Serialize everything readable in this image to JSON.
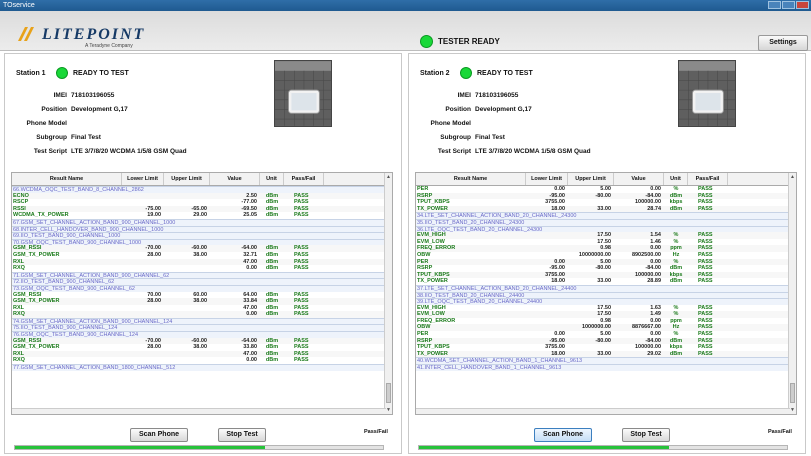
{
  "window": {
    "title": "TOservice"
  },
  "header": {
    "logo_text": "LITEPOINT",
    "logo_sub": "A Teradyne Company",
    "tester_status": "TESTER READY",
    "settings_label": "Settings"
  },
  "stations": [
    {
      "title": "Station 1",
      "status": "READY TO TEST",
      "info": {
        "imei_label": "IMEI",
        "imei": "718103196055",
        "position_label": "Position",
        "position": "Development G,17",
        "phone_model_label": "Phone Model",
        "phone_model": "",
        "subgroup_label": "Subgroup",
        "subgroup": "Final Test",
        "script_label": "Test Script",
        "script": "LTE 3/7/8/20 WCDMA 1/5/8 GSM Quad"
      },
      "buttons": {
        "scan": "Scan Phone",
        "stop": "Stop Test"
      },
      "pass_fail": "Pass/Fail",
      "progress": 0.68,
      "columns": [
        "Result Name",
        "Lower Limit",
        "Upper Limit",
        "Value",
        "Unit",
        "Pass/Fail"
      ],
      "rows": [
        {
          "s": 1,
          "name": "66.WCDMA_OQC_TEST_BAND_8_CHANNEL_2862"
        },
        {
          "name": "ECNO",
          "lo": "",
          "hi": "",
          "val": "2.50",
          "unit": "dBm",
          "pf": "PASS"
        },
        {
          "name": "RSCP",
          "lo": "",
          "hi": "",
          "val": "-77.00",
          "unit": "dBm",
          "pf": "PASS"
        },
        {
          "name": "RSSI",
          "lo": "-75.00",
          "hi": "-65.00",
          "val": "-69.50",
          "unit": "dBm",
          "pf": "PASS"
        },
        {
          "name": "WCDMA_TX_POWER",
          "lo": "19.00",
          "hi": "29.00",
          "val": "25.05",
          "unit": "dBm",
          "pf": "PASS"
        },
        {
          "s": 1,
          "name": "67.GSM_SET_CHANNEL_ACTION_BAND_900_CHANNEL_1000"
        },
        {
          "s": 1,
          "name": "68.INTER_CELL_HANDOVER_BAND_900_CHANNEL_1000"
        },
        {
          "s": 1,
          "name": "69.IIO_TEST_BAND_900_CHANNEL_1000"
        },
        {
          "s": 1,
          "name": "70.GSM_OQC_TEST_BAND_900_CHANNEL_1000"
        },
        {
          "name": "GSM_RSSI",
          "lo": "-70.00",
          "hi": "-60.00",
          "val": "-64.00",
          "unit": "dBm",
          "pf": "PASS"
        },
        {
          "name": "GSM_TX_POWER",
          "lo": "28.00",
          "hi": "38.00",
          "val": "32.71",
          "unit": "dBm",
          "pf": "PASS"
        },
        {
          "name": "RXL",
          "lo": "",
          "hi": "",
          "val": "47.00",
          "unit": "dBm",
          "pf": "PASS"
        },
        {
          "name": "RXQ",
          "lo": "",
          "hi": "",
          "val": "0.00",
          "unit": "dBm",
          "pf": "PASS"
        },
        {
          "s": 1,
          "name": "71.GSM_SET_CHANNEL_ACTION_BAND_900_CHANNEL_62"
        },
        {
          "s": 1,
          "name": "72.IIO_TEST_BAND_900_CHANNEL_62"
        },
        {
          "s": 1,
          "name": "73.GSM_OQC_TEST_BAND_900_CHANNEL_62"
        },
        {
          "name": "GSM_RSSI",
          "lo": "70.00",
          "hi": "60.00",
          "val": "64.00",
          "unit": "dBm",
          "pf": "PASS"
        },
        {
          "name": "GSM_TX_POWER",
          "lo": "28.00",
          "hi": "38.00",
          "val": "33.84",
          "unit": "dBm",
          "pf": "PASS"
        },
        {
          "name": "RXL",
          "lo": "",
          "hi": "",
          "val": "47.00",
          "unit": "dBm",
          "pf": "PASS"
        },
        {
          "name": "RXQ",
          "lo": "",
          "hi": "",
          "val": "0.00",
          "unit": "dBm",
          "pf": "PASS"
        },
        {
          "s": 1,
          "name": "74.GSM_SET_CHANNEL_ACTION_BAND_900_CHANNEL_124"
        },
        {
          "s": 1,
          "name": "75.IIO_TEST_BAND_900_CHANNEL_124"
        },
        {
          "s": 1,
          "name": "76.GSM_OQC_TEST_BAND_900_CHANNEL_124"
        },
        {
          "name": "GSM_RSSI",
          "lo": "-70.00",
          "hi": "-60.00",
          "val": "-64.00",
          "unit": "dBm",
          "pf": "PASS"
        },
        {
          "name": "GSM_TX_POWER",
          "lo": "28.00",
          "hi": "38.00",
          "val": "33.80",
          "unit": "dBm",
          "pf": "PASS"
        },
        {
          "name": "RXL",
          "lo": "",
          "hi": "",
          "val": "47.00",
          "unit": "dBm",
          "pf": "PASS"
        },
        {
          "name": "RXQ",
          "lo": "",
          "hi": "",
          "val": "0.00",
          "unit": "dBm",
          "pf": "PASS"
        },
        {
          "s": 1,
          "name": "77.GSM_SET_CHANNEL_ACTION_BAND_1800_CHANNEL_512"
        }
      ]
    },
    {
      "title": "Station 2",
      "status": "READY TO TEST",
      "info": {
        "imei_label": "IMEI",
        "imei": "718103196055",
        "position_label": "Position",
        "position": "Development G,17",
        "phone_model_label": "Phone Model",
        "phone_model": "",
        "subgroup_label": "Subgroup",
        "subgroup": "Final Test",
        "script_label": "Test Script",
        "script": "LTE 3/7/8/20 WCDMA 1/5/8 GSM Quad"
      },
      "buttons": {
        "scan": "Scan Phone",
        "stop": "Stop Test"
      },
      "pass_fail": "Pass/Fail",
      "progress": 0.68,
      "columns": [
        "Result Name",
        "Lower Limit",
        "Upper Limit",
        "Value",
        "Unit",
        "Pass/Fail"
      ],
      "rows": [
        {
          "name": "PER",
          "lo": "0.00",
          "hi": "5.00",
          "val": "0.00",
          "unit": "%",
          "pf": "PASS"
        },
        {
          "name": "RSRP",
          "lo": "-95.00",
          "hi": "-80.00",
          "val": "-84.00",
          "unit": "dBm",
          "pf": "PASS"
        },
        {
          "name": "TPUT_KBPS",
          "lo": "3755.00",
          "hi": "",
          "val": "100000.00",
          "unit": "kbps",
          "pf": "PASS"
        },
        {
          "name": "TX_POWER",
          "lo": "18.00",
          "hi": "33.00",
          "val": "28.74",
          "unit": "dBm",
          "pf": "PASS"
        },
        {
          "s": 1,
          "name": "34.LTE_SET_CHANNEL_ACTION_BAND_20_CHANNEL_24300"
        },
        {
          "s": 1,
          "name": "35.IIO_TEST_BAND_20_CHANNEL_24300"
        },
        {
          "s": 1,
          "name": "36.LTE_OQC_TEST_BAND_20_CHANNEL_24300"
        },
        {
          "name": "EVM_HIGH",
          "lo": "",
          "hi": "17.50",
          "val": "1.54",
          "unit": "%",
          "pf": "PASS"
        },
        {
          "name": "EVM_LOW",
          "lo": "",
          "hi": "17.50",
          "val": "1.46",
          "unit": "%",
          "pf": "PASS"
        },
        {
          "name": "FREQ_ERROR",
          "lo": "",
          "hi": "0.98",
          "val": "0.00",
          "unit": "ppm",
          "pf": "PASS"
        },
        {
          "name": "OBW",
          "lo": "",
          "hi": "10000000.00",
          "val": "8902500.00",
          "unit": "Hz",
          "pf": "PASS"
        },
        {
          "name": "PER",
          "lo": "0.00",
          "hi": "5.00",
          "val": "0.00",
          "unit": "%",
          "pf": "PASS"
        },
        {
          "name": "RSRP",
          "lo": "-95.00",
          "hi": "-80.00",
          "val": "-84.00",
          "unit": "dBm",
          "pf": "PASS"
        },
        {
          "name": "TPUT_KBPS",
          "lo": "3755.00",
          "hi": "",
          "val": "100000.00",
          "unit": "kbps",
          "pf": "PASS"
        },
        {
          "name": "TX_POWER",
          "lo": "18.00",
          "hi": "33.00",
          "val": "28.89",
          "unit": "dBm",
          "pf": "PASS"
        },
        {
          "s": 1,
          "name": "37.LTE_SET_CHANNEL_ACTION_BAND_20_CHANNEL_24400"
        },
        {
          "s": 1,
          "name": "38.IIO_TEST_BAND_20_CHANNEL_24400"
        },
        {
          "s": 1,
          "name": "39.LTE_OQC_TEST_BAND_20_CHANNEL_24400"
        },
        {
          "name": "EVM_HIGH",
          "lo": "",
          "hi": "17.50",
          "val": "1.63",
          "unit": "%",
          "pf": "PASS"
        },
        {
          "name": "EVM_LOW",
          "lo": "",
          "hi": "17.50",
          "val": "1.49",
          "unit": "%",
          "pf": "PASS"
        },
        {
          "name": "FREQ_ERROR",
          "lo": "",
          "hi": "0.98",
          "val": "0.00",
          "unit": "ppm",
          "pf": "PASS"
        },
        {
          "name": "OBW",
          "lo": "",
          "hi": "1000000.00",
          "val": "8876667.00",
          "unit": "Hz",
          "pf": "PASS"
        },
        {
          "name": "PER",
          "lo": "0.00",
          "hi": "5.00",
          "val": "0.00",
          "unit": "%",
          "pf": "PASS"
        },
        {
          "name": "RSRP",
          "lo": "-95.00",
          "hi": "-80.00",
          "val": "-84.00",
          "unit": "dBm",
          "pf": "PASS"
        },
        {
          "name": "TPUT_KBPS",
          "lo": "3755.00",
          "hi": "",
          "val": "100000.00",
          "unit": "kbps",
          "pf": "PASS"
        },
        {
          "name": "TX_POWER",
          "lo": "18.00",
          "hi": "33.00",
          "val": "29.02",
          "unit": "dBm",
          "pf": "PASS"
        },
        {
          "s": 1,
          "name": "40.WCDMA_SET_CHANNEL_ACTION_BAND_1_CHANNEL_9613"
        },
        {
          "s": 1,
          "name": "41.INTER_CELL_HANDOVER_BAND_1_CHANNEL_9613"
        }
      ]
    }
  ]
}
